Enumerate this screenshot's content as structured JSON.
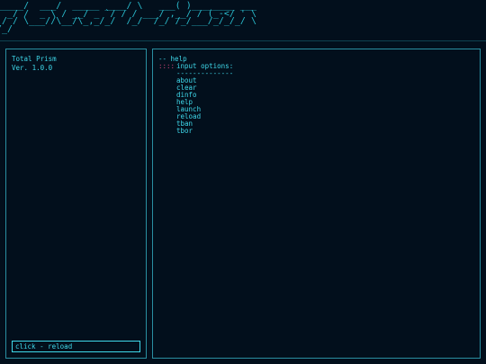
{
  "banner": {
    "art_lines": [
      "_____/  ___/  _____ ____/ \\   ___( )________ ___",
      "  _/ /  _ \\ / __/ _ `/ / / ___/ ,__/ / (_-</ ' \\",
      " / / \\___//\\__/\\_,_/_/  /_/  /_/ /_/___/_/_/_/ \\",
      "/_/                                             "
    ]
  },
  "info": {
    "app_name": "Total Prism",
    "version": "Ver. 1.0.0"
  },
  "command": {
    "input_value": "click - reload"
  },
  "output": {
    "command_line": "-- help",
    "prefix": "::::",
    "heading": "input options:",
    "divider": "--------------",
    "options": [
      "about",
      "clear",
      "dinfo",
      "help",
      "launch",
      "reload",
      "tban",
      "tbor"
    ]
  },
  "colors": {
    "background": "#020f1c",
    "text": "#3fd8ea",
    "border": "#2a8fa1",
    "prefix": "#d0457a"
  }
}
